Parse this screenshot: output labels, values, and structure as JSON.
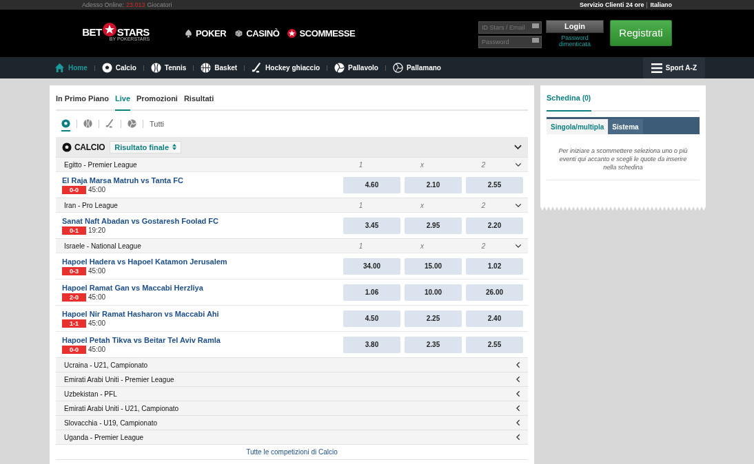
{
  "top_bar": {
    "online_label": "Adesso Online:",
    "online_count": "23.013",
    "online_suffix": "Giocatori",
    "service": "Servizio Clienti 24 ore",
    "language": "Italiano"
  },
  "header": {
    "logo": {
      "left": "BET",
      "right": "STARS",
      "tagline": "BY POKERSTARS"
    },
    "products": [
      {
        "kind": "poker",
        "label": "POKER"
      },
      {
        "kind": "casino",
        "label": "CASINÒ"
      },
      {
        "kind": "sports",
        "label": "SCOMMESSE"
      }
    ],
    "login": {
      "user_placeholder": "ID Stars / Email",
      "password_placeholder": "Password",
      "login_button": "Login",
      "forgot_link": "Password dimenticata",
      "register_button": "Registrati"
    }
  },
  "nav": {
    "items": [
      {
        "kind": "home",
        "label": "Home",
        "selected": true
      },
      {
        "kind": "football",
        "label": "Calcio",
        "selected": false
      },
      {
        "kind": "tennis",
        "label": "Tennis",
        "selected": false
      },
      {
        "kind": "basketball",
        "label": "Basket",
        "selected": false
      },
      {
        "kind": "hockey",
        "label": "Hockey ghiaccio",
        "selected": false
      },
      {
        "kind": "volleyball",
        "label": "Pallavolo",
        "selected": false
      },
      {
        "kind": "handball",
        "label": "Pallamano",
        "selected": false
      }
    ],
    "sport_az": "Sport A-Z"
  },
  "main_tabs": [
    {
      "label": "In Primo Piano",
      "selected": false
    },
    {
      "label": "Live",
      "selected": true
    },
    {
      "label": "Promozioni",
      "selected": false
    },
    {
      "label": "Risultati",
      "selected": false
    }
  ],
  "sport_filters": [
    {
      "kind": "football",
      "selected": true
    },
    {
      "kind": "tennis",
      "selected": false
    },
    {
      "kind": "hockey",
      "selected": false
    },
    {
      "kind": "volleyball",
      "selected": false
    },
    {
      "kind": "text",
      "label": "Tutti",
      "selected": false
    }
  ],
  "section": {
    "title": "CALCIO",
    "market": "Risultato finale",
    "expanded": true
  },
  "leagues": [
    {
      "name": "Egitto - Premier League",
      "expanded": true,
      "columns": [
        "1",
        "x",
        "2"
      ],
      "events": [
        {
          "name": "El Raja Marsa Matruh vs Tanta FC",
          "score": "0-0",
          "time": "45:00",
          "odds": [
            "4.60",
            "2.10",
            "2.55"
          ]
        }
      ]
    },
    {
      "name": "Iran - Pro League",
      "expanded": true,
      "columns": [
        "1",
        "x",
        "2"
      ],
      "events": [
        {
          "name": "Sanat Naft Abadan vs Gostaresh Foolad FC",
          "score": "0-1",
          "time": "19:20",
          "odds": [
            "3.45",
            "2.95",
            "2.20"
          ]
        }
      ]
    },
    {
      "name": "Israele - National League",
      "expanded": true,
      "columns": [
        "1",
        "x",
        "2"
      ],
      "events": [
        {
          "name": "Hapoel Hadera vs Hapoel Katamon Jerusalem",
          "score": "0-3",
          "time": "45:00",
          "odds": [
            "34.00",
            "15.00",
            "1.02"
          ]
        },
        {
          "name": "Hapoel Ramat Gan vs Maccabi Herzliya",
          "score": "2-0",
          "time": "45:00",
          "odds": [
            "1.06",
            "10.00",
            "26.00"
          ]
        },
        {
          "name": "Hapoel Nir Ramat Hasharon vs Maccabi Ahi",
          "score": "1-1",
          "time": "45:00",
          "odds": [
            "4.50",
            "2.25",
            "2.40"
          ]
        },
        {
          "name": "Hapoel Petah Tikva vs Beitar Tel Aviv Ramla",
          "score": "0-0",
          "time": "45:00",
          "odds": [
            "3.80",
            "2.35",
            "2.55"
          ]
        }
      ]
    },
    {
      "name": "Ucraina - U21, Campionato",
      "expanded": false
    },
    {
      "name": "Emirati Arabi Uniti - Premier League",
      "expanded": false
    },
    {
      "name": "Uzbekistan - PFL",
      "expanded": false
    },
    {
      "name": "Emirati Arabi Uniti - U21, Campionato",
      "expanded": false
    },
    {
      "name": "Slovacchia - U19, Campionato",
      "expanded": false
    },
    {
      "name": "Uganda - Premier League",
      "expanded": false
    }
  ],
  "all_competitions_link": "Tutte le competizioni di Calcio",
  "betslip": {
    "title": "Schedina",
    "count": "(0)",
    "tabs": [
      {
        "label": "Singola/multipla",
        "selected": true
      },
      {
        "label": "Sistema",
        "selected": false
      }
    ],
    "message": "Per iniziare a scommettere seleziona uno o più eventi qui accanto e scegli le quote da inserire nella schedina"
  }
}
